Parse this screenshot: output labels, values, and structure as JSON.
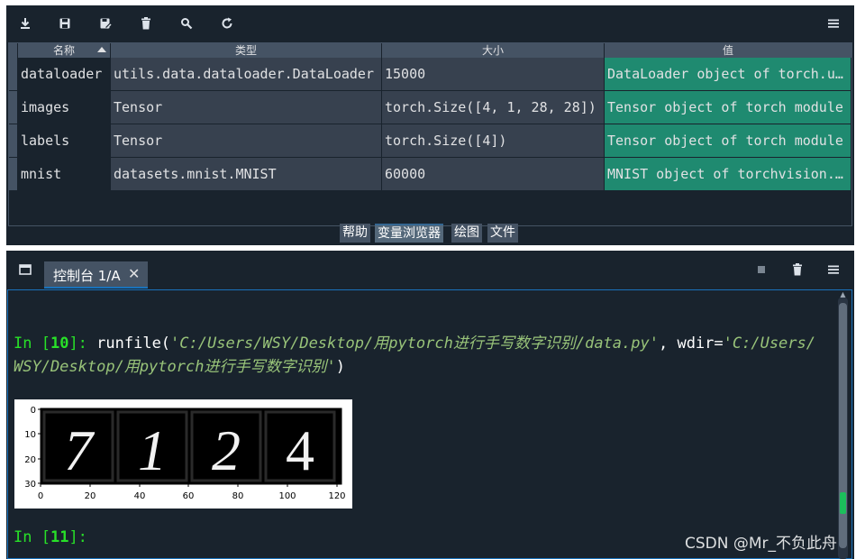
{
  "toolbar": {
    "icons": [
      "import-data-icon",
      "save-data-icon",
      "save-data-as-icon",
      "remove-all-icon",
      "search-icon",
      "refresh-icon",
      "options-menu-icon"
    ]
  },
  "var_table": {
    "headers": [
      "名称",
      "类型",
      "大小",
      "值"
    ],
    "rows": [
      {
        "name": "dataloader",
        "type": "utils.data.dataloader.DataLoader",
        "size": "15000",
        "value": "DataLoader object of torch.u…"
      },
      {
        "name": "images",
        "type": "Tensor",
        "size": "torch.Size([4, 1, 28, 28])",
        "value": "Tensor object of torch module"
      },
      {
        "name": "labels",
        "type": "Tensor",
        "size": "torch.Size([4])",
        "value": "Tensor object of torch module"
      },
      {
        "name": "mnist",
        "type": "datasets.mnist.MNIST",
        "size": "60000",
        "value": "MNIST object of torchvision.…"
      }
    ]
  },
  "pane_tabs": [
    "帮助",
    "变量浏览器",
    "绘图",
    "文件"
  ],
  "console": {
    "tab_label": "控制台 1/A",
    "close_glyph": "✕",
    "prompt_prefix": "In [",
    "prompt1_num": "10",
    "prompt_suffix": "]:",
    "cmd_fn": " runfile(",
    "cmd_arg1": "'C:/Users/WSY/Desktop/用pytorch进行手写数字识别/data.py'",
    "cmd_sep": ", wdir=",
    "cmd_arg2a": "'C:/Users/",
    "cmd_arg2b": "WSY/Desktop/用pytorch进行手写数字识别'",
    "cmd_end": ")",
    "prompt2_num": "11"
  },
  "plot": {
    "y_ticks": [
      "0",
      "10",
      "20",
      "30"
    ],
    "x_ticks": [
      "0",
      "20",
      "40",
      "60",
      "80",
      "100",
      "120"
    ],
    "digits": [
      "7",
      "1",
      "2",
      "4"
    ]
  },
  "watermark": "CSDN @Mr_不负此舟"
}
